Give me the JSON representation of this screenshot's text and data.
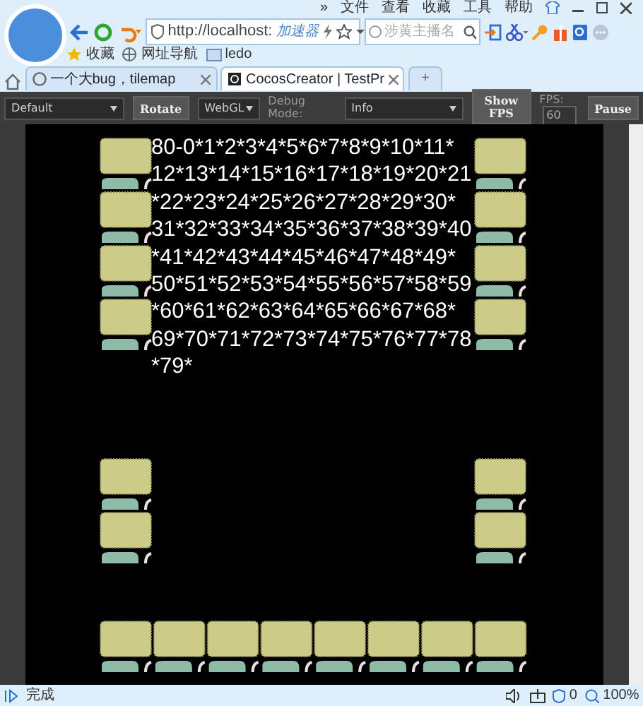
{
  "menu_bar": {
    "items": [
      "»",
      "文件",
      "查看",
      "收藏",
      "工具",
      "帮助"
    ]
  },
  "address_bar": {
    "url": "http://localhost:",
    "accelerator": "加速器"
  },
  "search": {
    "placeholder": "涉黄主播名"
  },
  "bookmarks": [
    "收藏",
    "网址导航",
    "ledo"
  ],
  "tabs": [
    {
      "title": "一个大bug，tilemap",
      "selected": false
    },
    {
      "title": "CocosCreator | TestPr",
      "selected": true
    }
  ],
  "new_tab": "+",
  "toolbar": [
    {
      "kind": "select",
      "value": "Default"
    },
    {
      "kind": "button",
      "label": "Rotate"
    },
    {
      "kind": "select",
      "value": "WebGL"
    },
    {
      "kind": "label",
      "text": "Debug Mode:"
    },
    {
      "kind": "select",
      "value": "Info"
    },
    {
      "kind": "button",
      "label": "Show FPS"
    },
    {
      "kind": "label",
      "text": "FPS:"
    },
    {
      "kind": "input",
      "value": "60"
    },
    {
      "kind": "button",
      "label": "Pause"
    }
  ],
  "game_text": {
    "lines": [
      "80-0*1*2*3*4*5*6*7*8*9*10*11*",
      "12*13*14*15*16*17*18*19*20*21",
      "*22*23*24*25*26*27*28*29*30*",
      "31*32*33*34*35*36*37*38*39*40",
      "*41*42*43*44*45*46*47*48*49*",
      "50*51*52*53*54*55*56*57*58*59",
      "*60*61*62*63*64*65*66*67*68*",
      "69*70*71*72*73*74*75*76*77*78",
      "*79*"
    ]
  },
  "status_bar": {
    "text": "完成",
    "blocked_count": "0",
    "zoom": "100%"
  }
}
